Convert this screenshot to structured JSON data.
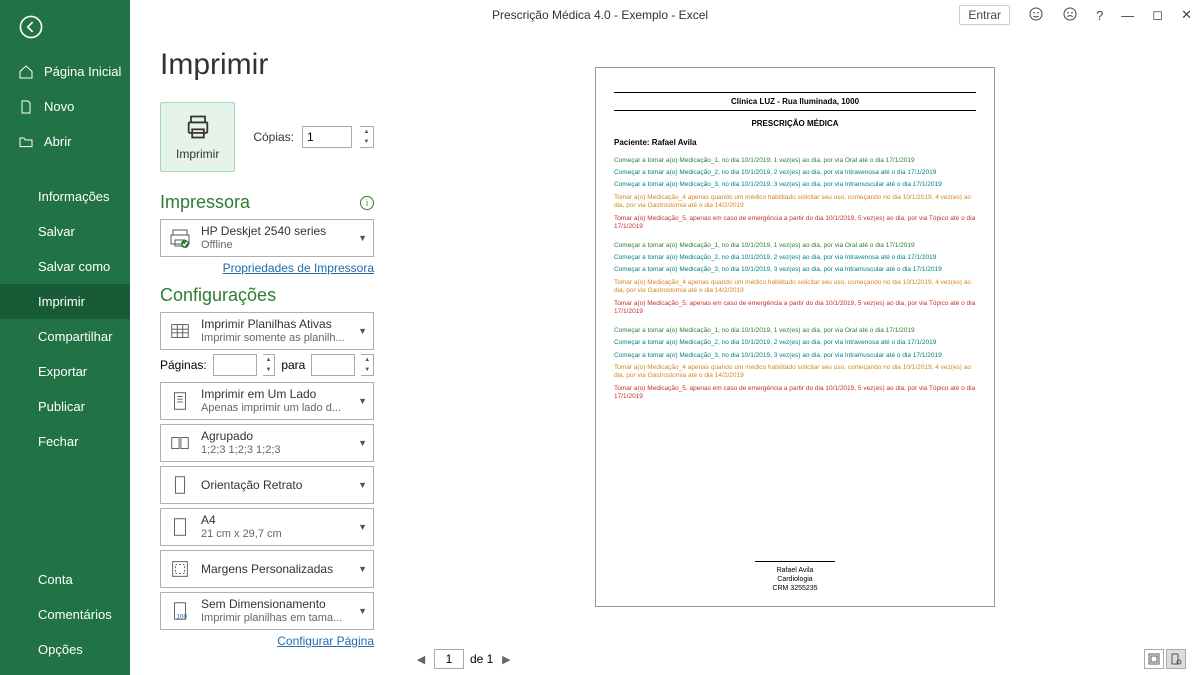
{
  "titlebar": {
    "title": "Prescrição Médica 4.0 - Exemplo  -  Excel",
    "signin": "Entrar"
  },
  "leftnav": {
    "top": [
      {
        "label": "Página Inicial",
        "icon": "home"
      },
      {
        "label": "Novo",
        "icon": "doc"
      },
      {
        "label": "Abrir",
        "icon": "folder"
      }
    ],
    "mid": [
      {
        "label": "Informações"
      },
      {
        "label": "Salvar"
      },
      {
        "label": "Salvar como"
      },
      {
        "label": "Imprimir",
        "selected": true
      },
      {
        "label": "Compartilhar"
      },
      {
        "label": "Exportar"
      },
      {
        "label": "Publicar"
      },
      {
        "label": "Fechar"
      }
    ],
    "bottom": [
      {
        "label": "Conta"
      },
      {
        "label": "Comentários"
      },
      {
        "label": "Opções"
      }
    ]
  },
  "print": {
    "heading": "Imprimir",
    "button": "Imprimir",
    "copies_label": "Cópias:",
    "copies_value": "1"
  },
  "printer": {
    "heading": "Impressora",
    "name": "HP Deskjet 2540 series",
    "status": "Offline",
    "properties_link": "Propriedades de Impressora"
  },
  "settings": {
    "heading": "Configurações",
    "sheets": {
      "t1": "Imprimir Planilhas Ativas",
      "t2": "Imprimir somente as planilh..."
    },
    "pages_label": "Páginas:",
    "pages_to": "para",
    "sides": {
      "t1": "Imprimir em Um Lado",
      "t2": "Apenas imprimir um lado d..."
    },
    "collate": {
      "t1": "Agrupado",
      "t2": "1;2;3    1;2;3    1;2;3"
    },
    "orientation": {
      "t1": "Orientação Retrato",
      "t2": ""
    },
    "paper": {
      "t1": "A4",
      "t2": "21 cm x 29,7 cm"
    },
    "margins": {
      "t1": "Margens Personalizadas",
      "t2": ""
    },
    "scaling": {
      "t1": "Sem Dimensionamento",
      "t2": "Imprimir planilhas em tama..."
    },
    "page_setup_link": "Configurar Página"
  },
  "preview": {
    "clinic": "Clínica LUZ - Rua Iluminada, 1000",
    "title": "PRESCRIÇÃO MÉDICA",
    "patient_label": "Paciente: Rafael Avila",
    "block": [
      {
        "cls": "c-green",
        "txt": "Começar a tomar a(o) Medicação_1, no dia 10/1/2019, 1 vez(es) ao dia, por via Oral até o dia 17/1/2019"
      },
      {
        "cls": "c-teal",
        "txt": "Começar a tomar a(o) Medicação_2, no dia 10/1/2019, 2 vez(es) ao dia, por via Intravenosa até o dia 17/1/2019"
      },
      {
        "cls": "c-teal",
        "txt": "Começar a tomar a(o) Medicação_3, no dia 10/1/2019, 3 vez(es) ao dia, por via Intramuscular até o dia 17/1/2019"
      },
      {
        "cls": "c-orange",
        "txt": "Tomar a(o) Medicação_4 apenas quando um médico habilitado solicitar seu uso, começando no dia 10/1/2019, 4 vez(es) ao dia, por via Gastrostomia até o dia 14/2/2019"
      },
      {
        "cls": "c-red",
        "txt": "Tomar a(o) Medicação_5, apenas em caso de emergência a partir do dia 10/1/2019, 5 vez(es) ao dia, por via Tópico até o dia 17/1/2019"
      }
    ],
    "signature": {
      "name": "Rafael Avila",
      "spec": "Cardiologia",
      "crm": "CRM 3255235"
    },
    "page_current": "1",
    "page_of": "de 1"
  }
}
